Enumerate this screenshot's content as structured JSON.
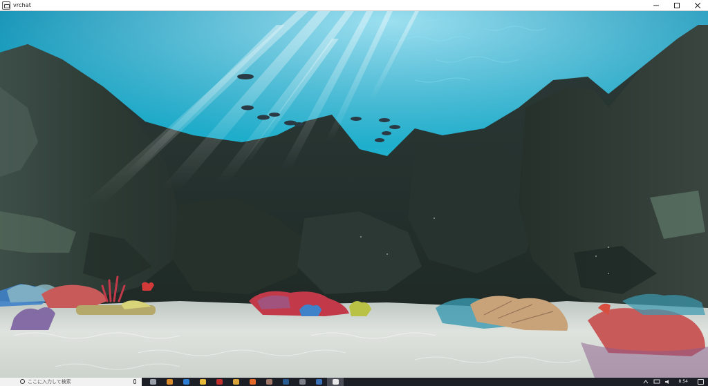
{
  "window": {
    "title": "vrchat",
    "controls": [
      "minimize-icon",
      "maximize-icon",
      "close-icon"
    ]
  },
  "scene": {
    "description_kind": "3d-viewport",
    "water_color": "#19a9c8",
    "rock_color": "#2e3a33",
    "sand_color": "#d8dcd6",
    "coral_colors": [
      "#c23a4a",
      "#d84f3f",
      "#3f82c9",
      "#b9c244",
      "#c8a37a",
      "#7b5fa0"
    ]
  },
  "taskbar": {
    "search_placeholder": "ここに入力して検索",
    "clock": "8:54",
    "apps": [
      {
        "icon": "task-view-icon",
        "color": "#9aa0aa"
      },
      {
        "icon": "store-icon",
        "color": "#d98a2b"
      },
      {
        "icon": "edge-icon",
        "color": "#2c7cd1"
      },
      {
        "icon": "folder-icon",
        "color": "#e7b93b"
      },
      {
        "icon": "app-red-icon",
        "color": "#c0302d"
      },
      {
        "icon": "chrome-icon",
        "color": "#d9a53a"
      },
      {
        "icon": "firefox-icon",
        "color": "#e46a2a"
      },
      {
        "icon": "photos-icon",
        "color": "#a0786a"
      },
      {
        "icon": "steam-icon",
        "color": "#2a5b8f"
      },
      {
        "icon": "app-gray-icon",
        "color": "#7b7f88"
      },
      {
        "icon": "app-blue-icon",
        "color": "#3b6fb6"
      },
      {
        "icon": "vrchat-icon",
        "color": "#e8e8e8"
      }
    ]
  }
}
